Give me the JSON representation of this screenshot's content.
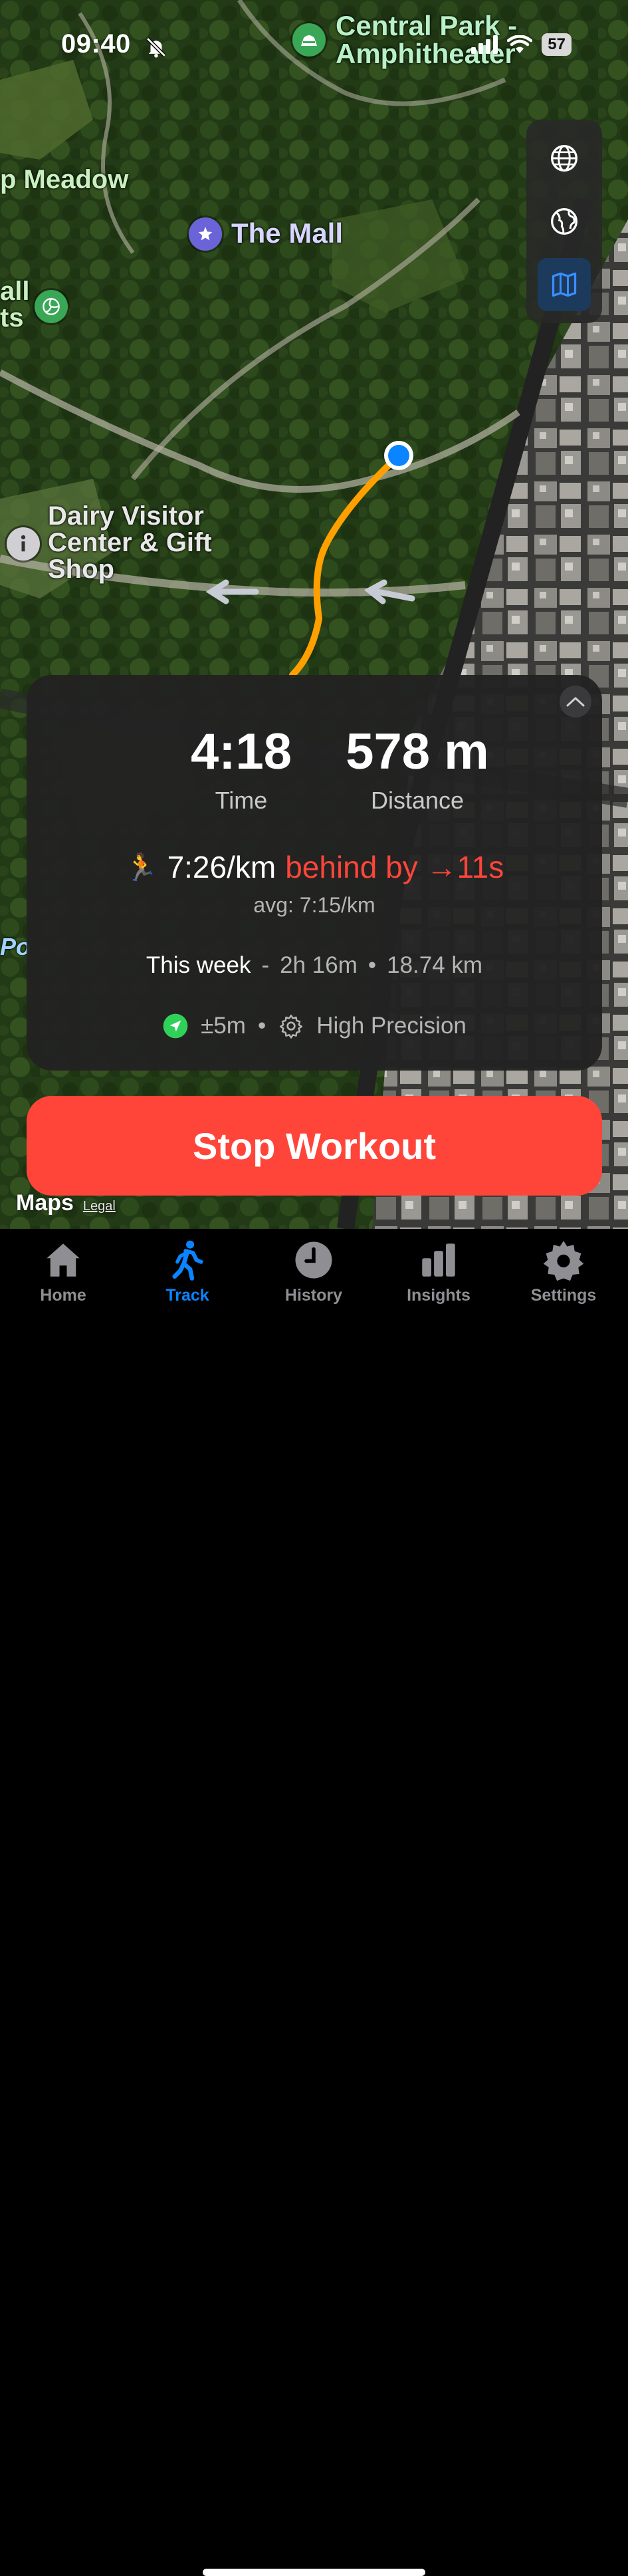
{
  "status_bar": {
    "time": "09:40",
    "battery": "57",
    "icons": [
      "bell-slash-icon",
      "signal-icon",
      "wifi-icon",
      "battery-icon"
    ]
  },
  "map": {
    "pois": [
      {
        "label": "Central Park - Amphitheater",
        "icon": "amphitheater-icon",
        "color": "#3aa757"
      },
      {
        "label": "p Meadow",
        "icon": "",
        "color": ""
      },
      {
        "label": "The Mall",
        "icon": "star-icon",
        "color": "#6a64d8"
      },
      {
        "label": "all ts",
        "icon": "volleyball-icon",
        "color": "#3aa757"
      },
      {
        "label": "Dairy Visitor Center & Gift Shop",
        "icon": "info-icon",
        "color": "#8e8e93"
      },
      {
        "label": "Po",
        "icon": "",
        "color": ""
      }
    ],
    "controls": [
      "globe-icon",
      "globe-outline-icon",
      "map-icon"
    ],
    "attribution": {
      "brand": "Maps",
      "legal": "Legal"
    }
  },
  "workout": {
    "time_value": "4:18",
    "time_label": "Time",
    "distance_value": "578 m",
    "distance_label": "Distance",
    "pace_emoji": "🏃",
    "pace": "7:26/km",
    "behind": "behind by →11s",
    "avg": "avg: 7:15/km",
    "week_title": "This week",
    "week_time": "2h 16m",
    "week_distance": "18.74 km",
    "gps_accuracy": "±5m",
    "precision_mode": "High Precision",
    "colors": {
      "behind": "#ff453a",
      "route": "#ffa000",
      "location": "#0a84ff",
      "gps": "#30d158"
    }
  },
  "stop_button": {
    "label": "Stop Workout",
    "color": "#ff453a"
  },
  "tabs": [
    {
      "label": "Home",
      "icon": "home-icon",
      "active": false
    },
    {
      "label": "Track",
      "icon": "walk-icon",
      "active": true
    },
    {
      "label": "History",
      "icon": "clock-icon",
      "active": false
    },
    {
      "label": "Insights",
      "icon": "bar-chart-icon",
      "active": false
    },
    {
      "label": "Settings",
      "icon": "gear-icon",
      "active": false
    }
  ]
}
